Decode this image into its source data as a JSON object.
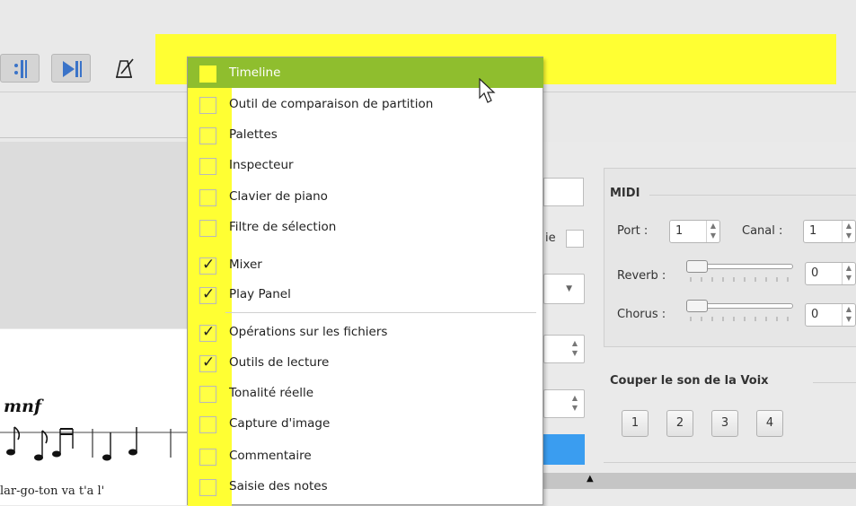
{
  "toolbar": {
    "buttons": [
      "repeat-end-icon",
      "play-to-end-icon",
      "metronome-icon"
    ],
    "highlight_color": "#ffff33"
  },
  "menu": {
    "items": [
      {
        "label": "Timeline",
        "checked": false,
        "highlighted": true
      },
      {
        "label": "Outil de comparaison de partition",
        "checked": false
      },
      {
        "label": "Palettes",
        "checked": false
      },
      {
        "label": "Inspecteur",
        "checked": false
      },
      {
        "label": "Clavier de piano",
        "checked": false
      },
      {
        "label": "Filtre de sélection",
        "checked": false
      },
      {
        "label": "Mixer",
        "checked": true
      },
      {
        "label": "Play Panel",
        "checked": true
      },
      {
        "label": "Opérations sur les fichiers",
        "checked": true
      },
      {
        "label": "Outils de lecture",
        "checked": true
      },
      {
        "label": "Tonalité réelle",
        "checked": false
      },
      {
        "label": "Capture d'image",
        "checked": false
      },
      {
        "label": "Commentaire",
        "checked": false
      },
      {
        "label": "Saisie des notes",
        "checked": false
      }
    ],
    "highlight_color": "#8fbe2e"
  },
  "mixer": {
    "partial_label": "ie",
    "midi_title": "MIDI",
    "port_label": "Port :",
    "port_value": "1",
    "channel_label": "Canal :",
    "channel_value": "1",
    "reverb_label": "Reverb :",
    "reverb_value": "0",
    "chorus_label": "Chorus :",
    "chorus_value": "0",
    "mute_voice_title": "Couper le son de la Voix",
    "voices": [
      "1",
      "2",
      "3",
      "4"
    ]
  },
  "score": {
    "dynamic": "mnf",
    "lyrics": "lar-go-ton   va   t'a    l'"
  }
}
